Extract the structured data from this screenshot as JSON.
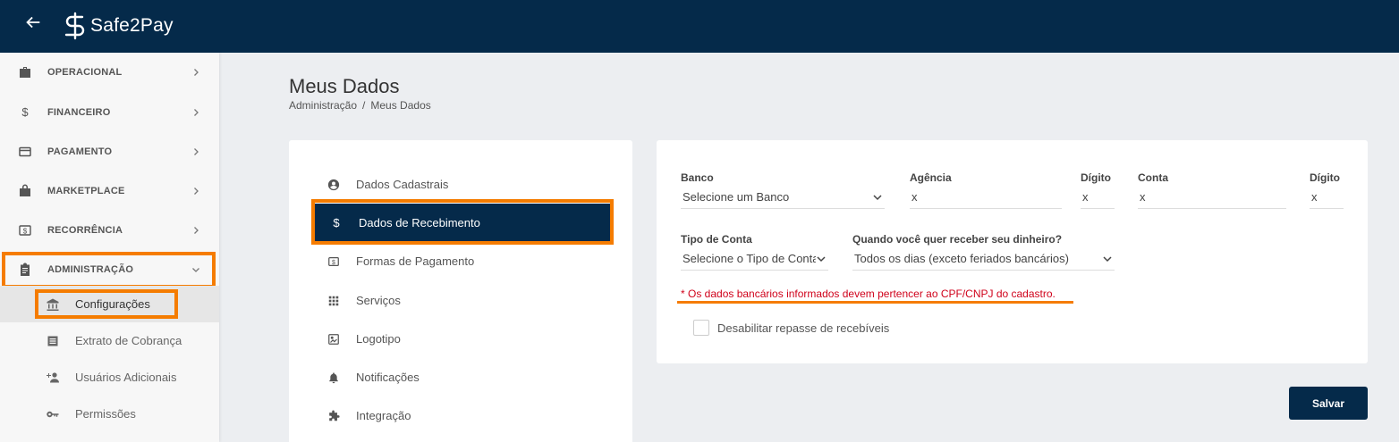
{
  "app": {
    "brand": "Safe2Pay"
  },
  "sidebar": {
    "items": [
      {
        "label": "OPERACIONAL",
        "icon": "briefcase-icon"
      },
      {
        "label": "FINANCEIRO",
        "icon": "dollar-icon"
      },
      {
        "label": "PAGAMENTO",
        "icon": "credit-card-icon"
      },
      {
        "label": "MARKETPLACE",
        "icon": "shopping-bag-icon"
      },
      {
        "label": "RECORRÊNCIA",
        "icon": "dollar-box-icon"
      },
      {
        "label": "ADMINISTRAÇÃO",
        "icon": "clipboard-icon"
      }
    ],
    "subitems": [
      {
        "label": "Configurações",
        "icon": "bank-icon"
      },
      {
        "label": "Extrato de Cobrança",
        "icon": "list-box-icon"
      },
      {
        "label": "Usuários Adicionais",
        "icon": "add-user-icon"
      },
      {
        "label": "Permissões",
        "icon": "key-icon"
      }
    ]
  },
  "page": {
    "title": "Meus Dados",
    "breadcrumb": [
      "Administração",
      "/",
      "Meus Dados"
    ]
  },
  "menu": {
    "items": [
      {
        "label": "Dados Cadastrais",
        "icon": "user-circle-icon"
      },
      {
        "label": "Dados de Recebimento",
        "icon": "dollar-icon"
      },
      {
        "label": "Formas de Pagamento",
        "icon": "dollar-box-icon"
      },
      {
        "label": "Serviços",
        "icon": "grid-icon"
      },
      {
        "label": "Logotipo",
        "icon": "image-icon"
      },
      {
        "label": "Notificações",
        "icon": "bell-icon"
      },
      {
        "label": "Integração",
        "icon": "puzzle-icon"
      }
    ]
  },
  "form": {
    "banco": {
      "label": "Banco",
      "value": "Selecione um Banco"
    },
    "agencia": {
      "label": "Agência",
      "value": "x"
    },
    "digito_agencia": {
      "label": "Dígito",
      "value": "x"
    },
    "conta": {
      "label": "Conta",
      "value": "x"
    },
    "digito_conta": {
      "label": "Dígito",
      "value": "x"
    },
    "tipo_conta": {
      "label": "Tipo de Conta",
      "value": "Selecione o Tipo de Conta"
    },
    "quando": {
      "label": "Quando você quer receber seu dinheiro?",
      "value": "Todos os dias (exceto feriados bancários)"
    },
    "notice": "* Os dados bancários informados devem pertencer ao CPF/CNPJ do cadastro.",
    "checkbox_label": "Desabilitar repasse de recebíveis",
    "checkbox_checked": false
  },
  "actions": {
    "save_label": "Salvar"
  },
  "colors": {
    "primary": "#052a4a",
    "highlight": "#f57c00",
    "warning": "#d0021b"
  }
}
